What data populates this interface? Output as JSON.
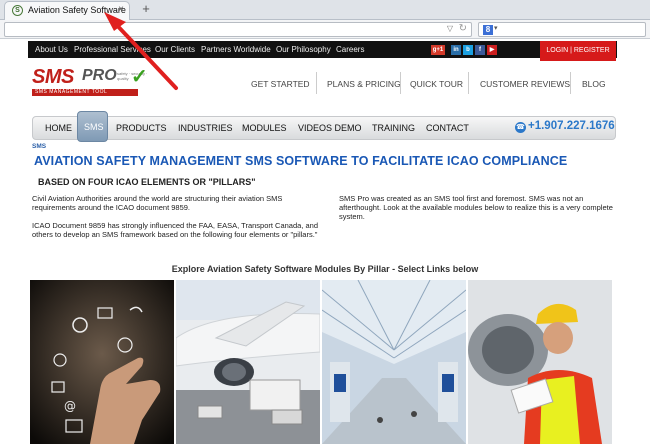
{
  "browser": {
    "tab_title": "Aviation Safety Software",
    "tab_close": "×",
    "new_tab": "+",
    "favicon": "S",
    "search_engine": "8"
  },
  "topbar": {
    "links": [
      "About Us",
      "Professional Services",
      "Our Clients",
      "Partners Worldwide",
      "Our Philosophy",
      "Careers"
    ],
    "social": [
      "g+1",
      "in",
      "b",
      "f",
      "▶"
    ],
    "login": "LOGIN | REGISTER"
  },
  "logo": {
    "name": "SMS",
    "name2": "PRO",
    "tagline": "safety · security · quality",
    "bar": "SMS MANAGEMENT TOOL"
  },
  "mainnav": [
    "GET STARTED",
    "PLANS & PRICING",
    "QUICK TOUR",
    "CUSTOMER REVIEWS",
    "BLOG"
  ],
  "subnav": {
    "items": [
      "HOME",
      "SMS",
      "PRODUCTS",
      "INDUSTRIES",
      "MODULES",
      "VIDEOS DEMO",
      "TRAINING",
      "CONTACT"
    ],
    "active": "SMS",
    "phone": "+1.907.227.1676"
  },
  "content": {
    "breadcrumb": "SMS",
    "headline": "AVIATION SAFETY MANAGEMENT SMS SOFTWARE TO FACILITATE ICAO COMPLIANCE",
    "subheadline": "BASED ON FOUR ICAO ELEMENTS OR \"PILLARS\"",
    "left_p1": "Civil Aviation Authorities around the world are structuring their aviation SMS requirements around the ICAO document 9859.",
    "left_p2": "ICAO Document 9859 has strongly influenced the FAA, EASA, Transport Canada, and others to develop an SMS framework based on the following four elements or \"pillars.\"",
    "right_p1": "SMS Pro was created as an SMS tool first and foremost. SMS was not an afterthought. Look at the available modules below to realize this is a very complete system.",
    "explore": "Explore Aviation Safety Software Modules By Pillar - Select Links below"
  },
  "colors": {
    "accent_blue": "#1a58b5",
    "login_red": "#d61a1a",
    "annotation_red": "#e0201f"
  }
}
